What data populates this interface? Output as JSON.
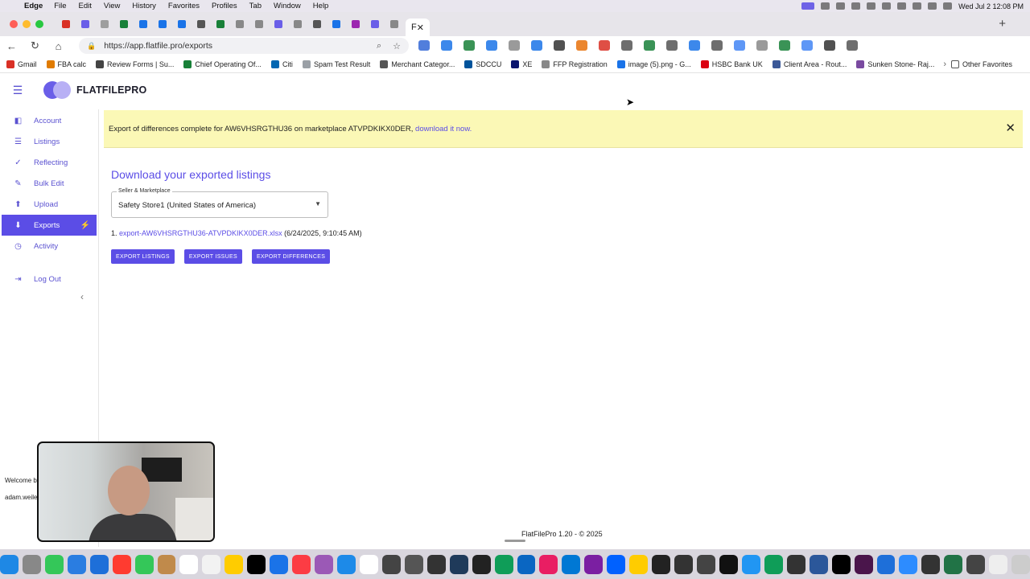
{
  "menubar": {
    "app": "Edge",
    "items": [
      "File",
      "Edit",
      "View",
      "History",
      "Favorites",
      "Profiles",
      "Tab",
      "Window",
      "Help"
    ],
    "clock": "Wed Jul 2  12:08 PM"
  },
  "browser": {
    "url": "https://app.flatfile.pro/exports",
    "tab_title": "F"
  },
  "bookmarks": [
    {
      "label": "Gmail",
      "color": "#d93025"
    },
    {
      "label": "FBA calc",
      "color": "#e07b00"
    },
    {
      "label": "Review Forms | Su...",
      "color": "#444444"
    },
    {
      "label": "Chief Operating Of...",
      "color": "#188038"
    },
    {
      "label": "Citi",
      "color": "#0066b2"
    },
    {
      "label": "Spam Test Result",
      "color": "#9aa0a6"
    },
    {
      "label": "Merchant Categor...",
      "color": "#555555"
    },
    {
      "label": "SDCCU",
      "color": "#00539b"
    },
    {
      "label": "XE",
      "color": "#0a146e"
    },
    {
      "label": "FFP Registration",
      "color": "#888888"
    },
    {
      "label": "image (5).png - G...",
      "color": "#1a73e8"
    },
    {
      "label": "HSBC Bank UK",
      "color": "#db0011"
    },
    {
      "label": "Client Area - Rout...",
      "color": "#3b5998"
    },
    {
      "label": "Sunken Stone- Raj...",
      "color": "#7a4aa0"
    }
  ],
  "bookmarks_other": "Other Favorites",
  "app": {
    "brand": "FLATFILEPRO",
    "accent": "#5b4de6"
  },
  "sidebar": {
    "items": [
      {
        "label": "Account",
        "icon": "account-icon",
        "glyph": "◧"
      },
      {
        "label": "Listings",
        "icon": "listings-icon",
        "glyph": "☰"
      },
      {
        "label": "Reflecting",
        "icon": "reflecting-icon",
        "glyph": "✓"
      },
      {
        "label": "Bulk Edit",
        "icon": "bulk-edit-icon",
        "glyph": "✎"
      },
      {
        "label": "Upload",
        "icon": "upload-icon",
        "glyph": "⬆"
      },
      {
        "label": "Exports",
        "icon": "download-icon",
        "glyph": "⬇"
      },
      {
        "label": "Activity",
        "icon": "clock-icon",
        "glyph": "◷"
      }
    ],
    "logout": "Log Out",
    "overflow_text_1": "Welcome b",
    "overflow_text_2": "adam.weile"
  },
  "banner": {
    "message": "Export of differences complete for AW6VHSRGTHU36 on marketplace ATVPDKIKX0DER, ",
    "link": "download it now."
  },
  "main": {
    "title": "Download your exported listings",
    "select_label": "Seller & Marketplace",
    "select_value": "Safety Store1 (United States of America)",
    "export_index": "1.",
    "export_file": "export-AW6VHSRGTHU36-ATVPDKIKX0DER.xlsx",
    "export_time": "(6/24/2025, 9:10:45 AM)",
    "buttons": {
      "listings": "EXPORT LISTINGS",
      "issues": "EXPORT ISSUES",
      "differences": "EXPORT DIFFERENCES"
    }
  },
  "footer": "FlatFilePro 1.20 - © 2025"
}
